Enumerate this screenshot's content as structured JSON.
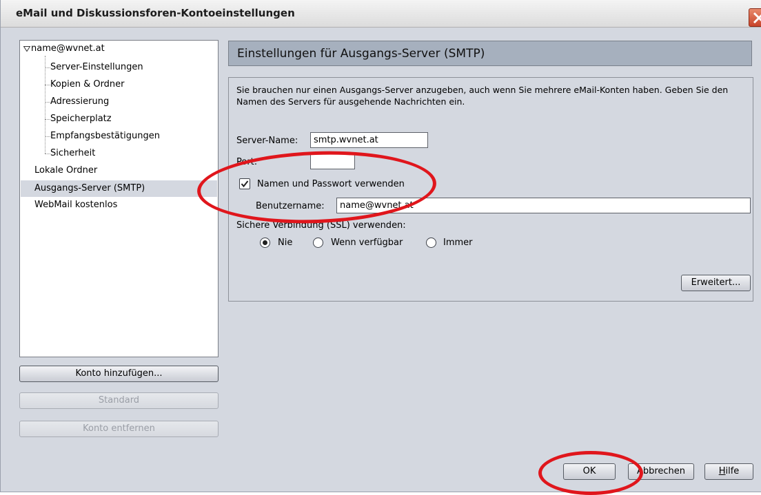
{
  "window": {
    "title": "eMail und Diskussionsforen-Kontoeinstellungen"
  },
  "tree": {
    "account": "name@wvnet.at",
    "children": [
      "Server-Einstellungen",
      "Kopien & Ordner",
      "Adressierung",
      "Speicherplatz",
      "Empfangsbestätigungen",
      "Sicherheit"
    ],
    "local_folders": "Lokale Ordner",
    "smtp": "Ausgangs-Server (SMTP)",
    "webmail": "WebMail kostenlos"
  },
  "left_buttons": {
    "add_account": "Konto hinzufügen...",
    "default": "Standard",
    "remove_account": "Konto entfernen"
  },
  "panel": {
    "heading": "Einstellungen für Ausgangs-Server (SMTP)",
    "description": "Sie brauchen nur einen Ausgangs-Server anzugeben, auch wenn Sie mehrere eMail-Konten haben. Geben Sie den Namen des Servers für ausgehende Nachrichten ein.",
    "server_name_label": "Server-Name:",
    "server_name_value": "smtp.wvnet.at",
    "port_label": "Port:",
    "port_value": "",
    "use_auth_label": "Namen und Passwort verwenden",
    "use_auth_checked": true,
    "username_label": "Benutzername:",
    "username_value": "name@wvnet.at",
    "ssl_label": "Sichere Verbindung (SSL) verwenden:",
    "ssl_options": [
      "Nie",
      "Wenn verfügbar",
      "Immer"
    ],
    "ssl_selected": "Nie",
    "advanced_button": "Erweitert..."
  },
  "footer": {
    "ok": "OK",
    "cancel": "Abbrechen",
    "help": "Hilfe"
  },
  "colors": {
    "annotation": "#e0161c",
    "selection": "#d4d8e0",
    "header_bg": "#a6b0be"
  }
}
